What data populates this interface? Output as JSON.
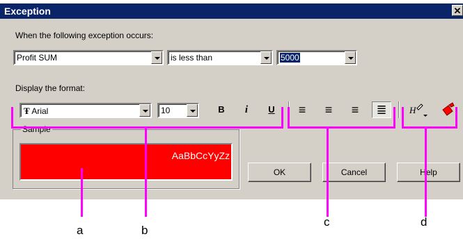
{
  "window": {
    "title": "Exception",
    "close_label": "✕"
  },
  "condition": {
    "label": "When the following exception occurs:",
    "field": "Profit SUM",
    "operator": "is less than",
    "value": "5000"
  },
  "format": {
    "label": "Display the format:",
    "font_icon_glyph": "Ŧ",
    "font_name": "Arial",
    "font_size": "10",
    "bold": "B",
    "italic": "i",
    "underline": "U",
    "align_left": "≡",
    "align_center": "≡",
    "align_right": "≡",
    "align_justify": "≣"
  },
  "sample": {
    "title": "Sample",
    "text": "AaBbCcYyZz"
  },
  "buttons": {
    "ok": "OK",
    "cancel": "Cancel",
    "help": "Help"
  },
  "callouts": {
    "a": "a",
    "b": "b",
    "c": "c",
    "d": "d"
  },
  "colors": {
    "accent_magenta": "#ff00ff",
    "sample_background": "#ff0000",
    "titlebar": "#0a246a"
  }
}
